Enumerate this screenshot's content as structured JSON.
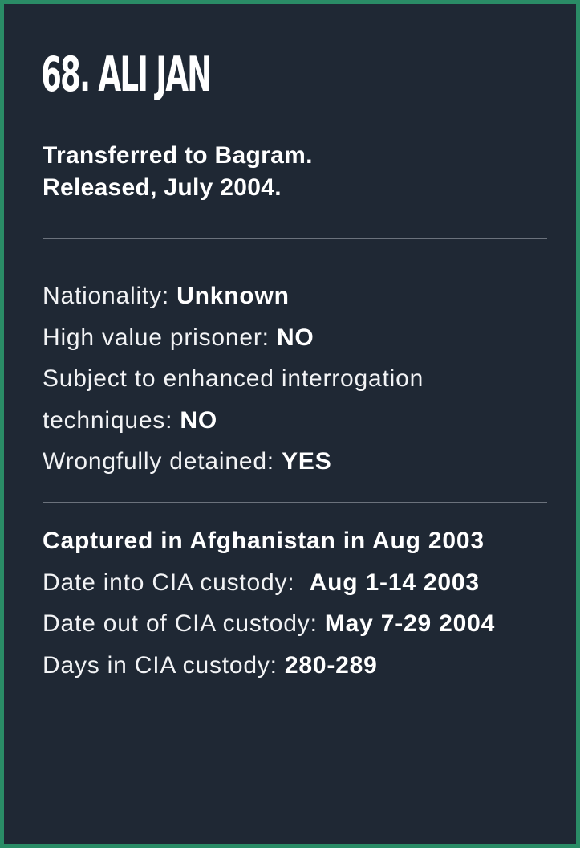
{
  "title": "68. ALI JAN",
  "status": {
    "line1": "Transferred to Bagram.",
    "line2": "Released, July 2004."
  },
  "facts": {
    "nationality_label": "Nationality: ",
    "nationality_value": "Unknown",
    "hvp_label": "High value prisoner: ",
    "hvp_value": "NO",
    "eit_label_line1": "Subject to enhanced interrogation",
    "eit_label_line2": "techniques: ",
    "eit_value": "NO",
    "wrongful_label": "Wrongfully detained: ",
    "wrongful_value": "YES"
  },
  "custody": {
    "captured": "Captured in Afghanistan in Aug 2003",
    "date_in_label": "Date into CIA custody:  ",
    "date_in_value": "Aug 1-14 2003",
    "date_out_label": "Date out of CIA custody: ",
    "date_out_value": "May 7-29 2004",
    "days_label": "Days in CIA custody: ",
    "days_value": "280-289"
  },
  "colors": {
    "background": "#1f2834",
    "border": "#2a8c66",
    "text": "#ffffff",
    "divider": "#6b727c"
  }
}
